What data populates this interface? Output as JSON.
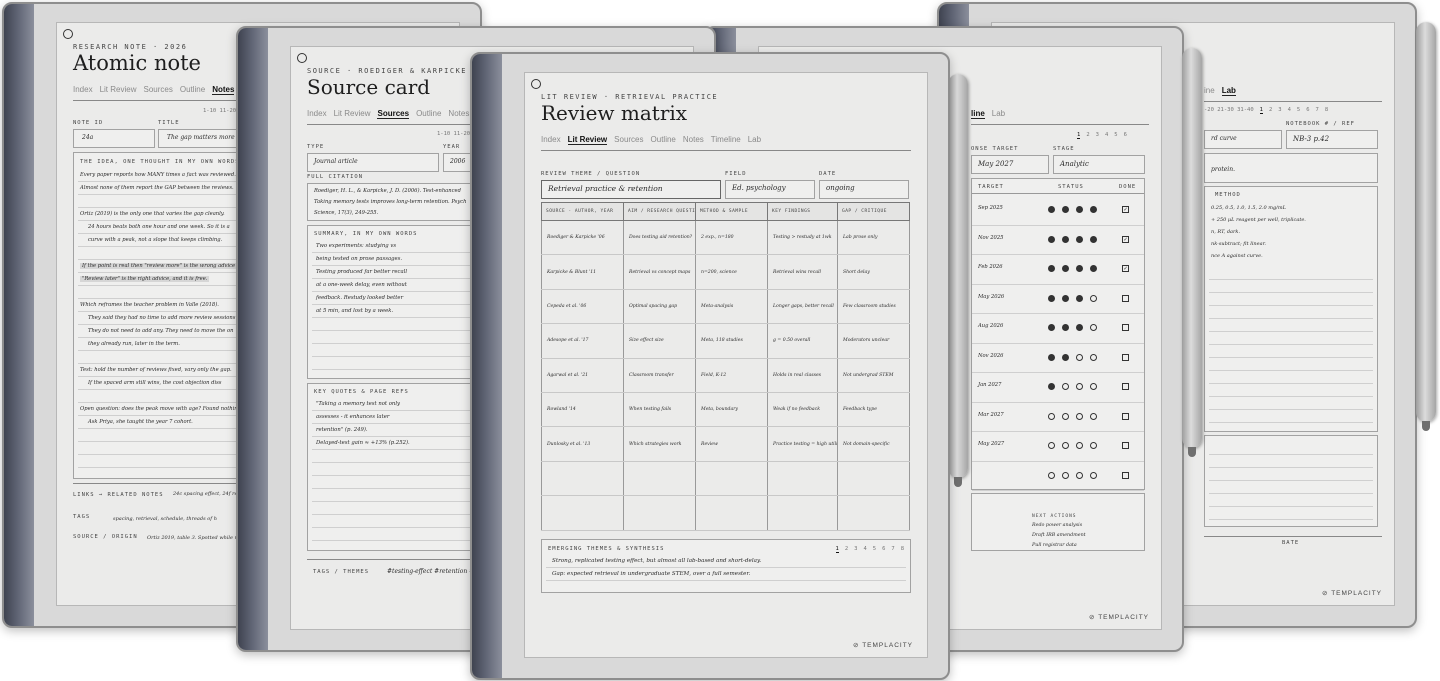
{
  "brand": "TEMPLACITY",
  "tabs": [
    "Index",
    "Lit Review",
    "Sources",
    "Outline",
    "Notes",
    "Timeline",
    "Lab"
  ],
  "page_numbers": [
    "1",
    "2",
    "3",
    "4",
    "5",
    "6",
    "7",
    "8"
  ],
  "atomic": {
    "kicker": "RESEARCH NOTE · 2026",
    "title": "Atomic note",
    "active_tab": "Notes",
    "page_range": "1-10  11-20",
    "note_id_label": "NOTE ID",
    "note_id": "24a",
    "title_label": "TITLE",
    "title_value": "The gap matters more th",
    "idea_label": "THE IDEA, ONE THOUGHT IN MY OWN WORDS",
    "lines": [
      "Every paper reports how MANY times a fact was reviewed.",
      "Almost none of them report the GAP between the reviews.",
      "",
      "Ortiz (2019) is the only one that varies the gap cleanly.",
      "24 hours beats both one hour and one week. So it is a",
      "curve with a peak, not a slope that keeps climbing.",
      "",
      "If the point is real then \"review more\" is the wrong advice",
      "\"Review later\" is the right advice, and it is free.",
      "",
      "Which reframes the teacher problem in Valle (2018).",
      "They said they had no time to add more review sessions",
      "They do not need to add any. They need to move the on",
      "they already run, later in the term.",
      "",
      "Test: hold the number of reviews fixed, vary only the gap.",
      "If the spaced arm still wins, the cost objection diss",
      "",
      "Open question: does the peak move with age? Found nothing",
      "Ask Priya, she taught the year 7 cohort."
    ],
    "links_label": "LINKS → RELATED NOTES",
    "links_value": "24c spacing effect, 24f retrieval",
    "tags_label": "TAGS",
    "tags_value": "spacing, retrieval, schedule, threads of h",
    "source_label": "SOURCE / ORIGIN",
    "source_value": "Ortiz 2019, table 3. Spotted while re"
  },
  "source": {
    "kicker": "SOURCE · ROEDIGER & KARPICKE 2006",
    "title": "Source card",
    "active_tab": "Sources",
    "page_range": "1-10  11-20",
    "type_label": "TYPE",
    "type_value": "Journal article",
    "year_label": "YEAR",
    "year_value": "2006",
    "citation_label": "FULL CITATION",
    "citation_lines": [
      "Roediger, H. L., & Karpicke, J. D. (2006). Test-enhanced",
      "Taking memory tests improves long-term retention. Psych",
      "Science, 17(3), 249-255."
    ],
    "summary_label": "SUMMARY, IN MY OWN WORDS",
    "summary_lines": [
      "Two experiments: studying vs",
      "being tested on prose passages.",
      "Testing produced far better recall",
      "at a one-week delay, even without",
      "feedback. Restudy looked better",
      "at 5 min, and lost by a week."
    ],
    "quotes_label": "KEY QUOTES & PAGE REFS",
    "quotes_lines": [
      "\"Taking a memory test not only",
      "assesses - it enhances later",
      "retention\" (p. 249).",
      "Delayed-test gain ≈ +13% (p.252)."
    ],
    "tags_label": "TAGS / THEMES",
    "tags_value": "#testing-effect  #retention  #l"
  },
  "review": {
    "kicker": "LIT REVIEW · RETRIEVAL PRACTICE",
    "title": "Review matrix",
    "active_tab": "Lit Review",
    "theme_label": "REVIEW THEME / QUESTION",
    "theme_value": "Retrieval practice & retention",
    "field_label": "FIELD",
    "field_value": "Ed. psychology",
    "date_label": "DATE",
    "date_value": "ongoing",
    "columns": [
      "SOURCE · AUTHOR, YEAR",
      "AIM / RESEARCH QUESTION",
      "METHOD & SAMPLE",
      "KEY FINDINGS",
      "GAP / CRITIQUE"
    ],
    "rows": [
      [
        "Roediger & Karpicke '06",
        "Does testing aid retention?",
        "2 exp., n=180",
        "Testing > restudy at 1wk",
        "Lab prose only"
      ],
      [
        "Karpicke & Blunt '11",
        "Retrieval vs concept maps",
        "n=200, science",
        "Retrieval wins recall",
        "Short delay"
      ],
      [
        "Cepeda et al. '06",
        "Optimal spacing gap",
        "Meta-analysis",
        "Longer gaps, better recall",
        "Few classroom studies"
      ],
      [
        "Adesope et al. '17",
        "Size effect size",
        "Meta, 118 studies",
        "g = 0.50 overall",
        "Moderators unclear"
      ],
      [
        "Agarwal et al. '21",
        "Classroom transfer",
        "Field, K-12",
        "Holds in real classes",
        "Not undergrad STEM"
      ],
      [
        "Rowland '14",
        "When testing fails",
        "Meta, boundary",
        "Weak if no feedback",
        "Feedback type"
      ],
      [
        "Dunlosky et al. '13",
        "Which strategies work",
        "Review",
        "Practice testing = high utility",
        "Not domain-specific"
      ],
      [
        "",
        "",
        "",
        "",
        ""
      ],
      [
        "",
        "",
        "",
        "",
        ""
      ]
    ],
    "themes_label": "EMERGING THEMES & SYNTHESIS",
    "themes_lines": [
      "Strong, replicated testing effect, but almost all lab-based and short-delay.",
      "Gap: expected retrieval in undergraduate STEM, over a full semester."
    ]
  },
  "tracker": {
    "active_tab": "Timeline",
    "tabs_visible": [
      "line",
      "Lab"
    ],
    "target_label": "ONSE TARGET",
    "target_value": "May 2027",
    "stage_label": "STAGE",
    "stage_value": "Analytic",
    "col_target": "TARGET",
    "col_status": "STATUS",
    "col_done": "DONE",
    "rows": [
      {
        "date": "Sep 2025",
        "filled": 4,
        "done": true
      },
      {
        "date": "Nov 2025",
        "filled": 4,
        "done": true
      },
      {
        "date": "Feb 2026",
        "filled": 4,
        "done": true
      },
      {
        "date": "May 2026",
        "filled": 3,
        "done": false
      },
      {
        "date": "Aug 2026",
        "filled": 3,
        "done": false
      },
      {
        "date": "Nov 2026",
        "filled": 2,
        "done": false
      },
      {
        "date": "Jan 2027",
        "filled": 1,
        "done": false
      },
      {
        "date": "Mar 2027",
        "filled": 0,
        "done": false
      },
      {
        "date": "May 2027",
        "filled": 0,
        "done": false
      },
      {
        "date": "",
        "filled": 0,
        "done": false
      }
    ],
    "next_label": "NEXT ACTIONS",
    "next_items": [
      "Redo power analysis",
      "Draft IRB amendment",
      "Pull registrar data"
    ]
  },
  "lab": {
    "active_tab": "Lab",
    "tabs_visible": [
      "ine",
      "Lab"
    ],
    "page_range": "-20  21-30  31-40",
    "notebook_label": "NOTEBOOK # / REF",
    "notebook_value": "NB-3 p.42",
    "title_value": "rd curve",
    "aim_line": "protein.",
    "method_label": "METHOD",
    "method_lines": [
      "0.25, 0.5, 1.0, 1.5, 2.0 mg/mL",
      "+ 250 µL reagent per well, triplicate.",
      "n, RT, dark.",
      "nk-subtract; fit linear.",
      "nce A against curve."
    ],
    "bottom_label": "BATE"
  }
}
